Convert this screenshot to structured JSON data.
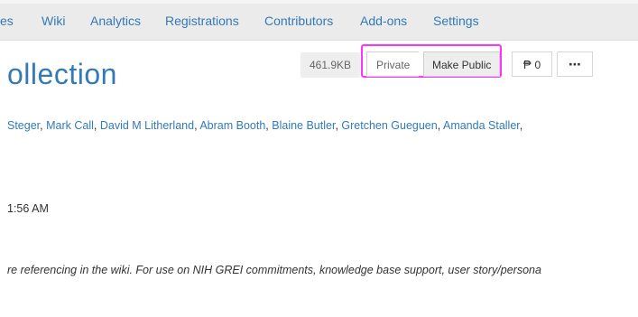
{
  "nav": {
    "items": [
      "es",
      "Wiki",
      "Analytics",
      "Registrations",
      "Contributors",
      "Add-ons",
      "Settings"
    ]
  },
  "project": {
    "title": "ollection",
    "size": "461.9KB",
    "visibility_label": "Private",
    "make_public_label": "Make Public",
    "fork_count": "0",
    "more_label": "⋯"
  },
  "contributors": [
    "Steger",
    "Mark Call",
    "David M Litherland",
    "Abram Booth",
    "Blaine Butler",
    "Gretchen Gueguen",
    "Amanda Staller"
  ],
  "meta": {
    "time": "1:56 AM",
    "description": "re referencing in the wiki. For use on NIH GREI commitments, knowledge base support, user story/persona"
  },
  "colors": {
    "link": "#337ab7",
    "highlight": "#ff33ff",
    "nav_bg": "#ebebeb"
  }
}
